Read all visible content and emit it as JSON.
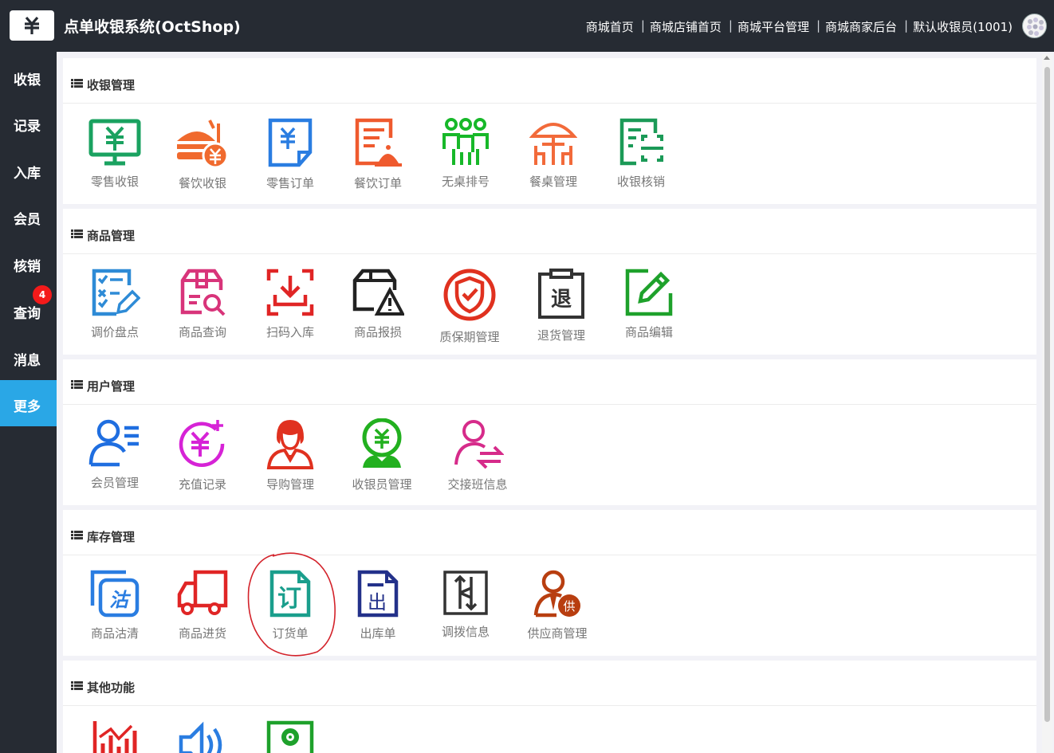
{
  "header": {
    "app_title": "点单收银系统(OctShop)",
    "links": [
      "商城首页",
      "商城店铺首页",
      "商城平台管理",
      "商城商家后台",
      "默认收银员(1001)"
    ]
  },
  "sidebar": {
    "items": [
      {
        "label": "收银"
      },
      {
        "label": "记录"
      },
      {
        "label": "入库"
      },
      {
        "label": "会员"
      },
      {
        "label": "核销"
      },
      {
        "label": "查询"
      },
      {
        "label": "消息",
        "badge": "4"
      },
      {
        "label": "更多",
        "active": true
      }
    ]
  },
  "sections": [
    {
      "title": "收银管理",
      "items": [
        {
          "label": "零售收银",
          "icon": "monitor-yen-icon",
          "color": "#1aa260"
        },
        {
          "label": "餐饮收银",
          "icon": "burger-drink-yen-icon",
          "color": "#f06a2e"
        },
        {
          "label": "零售订单",
          "icon": "document-yen-icon",
          "color": "#2a7de1"
        },
        {
          "label": "餐饮订单",
          "icon": "document-dish-icon",
          "color": "#ef5a2e"
        },
        {
          "label": "无桌排号",
          "icon": "queue-people-icon",
          "color": "#17b829"
        },
        {
          "label": "餐桌管理",
          "icon": "parasol-table-icon",
          "color": "#f26a3a"
        },
        {
          "label": "收银核销",
          "icon": "scan-document-icon",
          "color": "#1b9a57"
        }
      ]
    },
    {
      "title": "商品管理",
      "items": [
        {
          "label": "调价盘点",
          "icon": "checklist-pencil-icon",
          "color": "#2e8bd6"
        },
        {
          "label": "商品查询",
          "icon": "box-search-icon",
          "color": "#d8347a"
        },
        {
          "label": "扫码入库",
          "icon": "scan-inbox-icon",
          "color": "#e02525"
        },
        {
          "label": "商品报损",
          "icon": "box-warning-icon",
          "color": "#222222"
        },
        {
          "label": "质保期管理",
          "icon": "shield-check-icon",
          "color": "#e0311f"
        },
        {
          "label": "退货管理",
          "icon": "clipboard-return-icon",
          "color": "#333333"
        },
        {
          "label": "商品编辑",
          "icon": "edit-square-icon",
          "color": "#1ea12b"
        }
      ]
    },
    {
      "title": "用户管理",
      "items": [
        {
          "label": "会员管理",
          "icon": "member-list-icon",
          "color": "#1f6ee0"
        },
        {
          "label": "充值记录",
          "icon": "recharge-yen-icon",
          "color": "#d623d6"
        },
        {
          "label": "导购管理",
          "icon": "shopping-guide-icon",
          "color": "#e0311f"
        },
        {
          "label": "收银员管理",
          "icon": "cashier-yen-icon",
          "color": "#22b01f"
        },
        {
          "label": "交接班信息",
          "icon": "user-swap-icon",
          "color": "#d62b8a"
        }
      ]
    },
    {
      "title": "库存管理",
      "items": [
        {
          "label": "商品沽清",
          "icon": "sold-out-icon",
          "color": "#2a7de1"
        },
        {
          "label": "商品进货",
          "icon": "truck-icon",
          "color": "#e02525"
        },
        {
          "label": "订货单",
          "icon": "order-document-icon",
          "color": "#1a9e8c"
        },
        {
          "label": "出库单",
          "icon": "outbound-document-icon",
          "color": "#23318a"
        },
        {
          "label": "调拨信息",
          "icon": "transfer-icon",
          "color": "#333333"
        },
        {
          "label": "供应商管理",
          "icon": "supplier-icon",
          "color": "#b83e10"
        }
      ]
    },
    {
      "title": "其他功能",
      "items": [
        {
          "label": "",
          "icon": "bar-chart-icon",
          "color": "#e02525"
        },
        {
          "label": "",
          "icon": "speaker-icon",
          "color": "#2a7de1"
        },
        {
          "label": "",
          "icon": "settings-box-icon",
          "color": "#1ea12b"
        }
      ]
    }
  ]
}
